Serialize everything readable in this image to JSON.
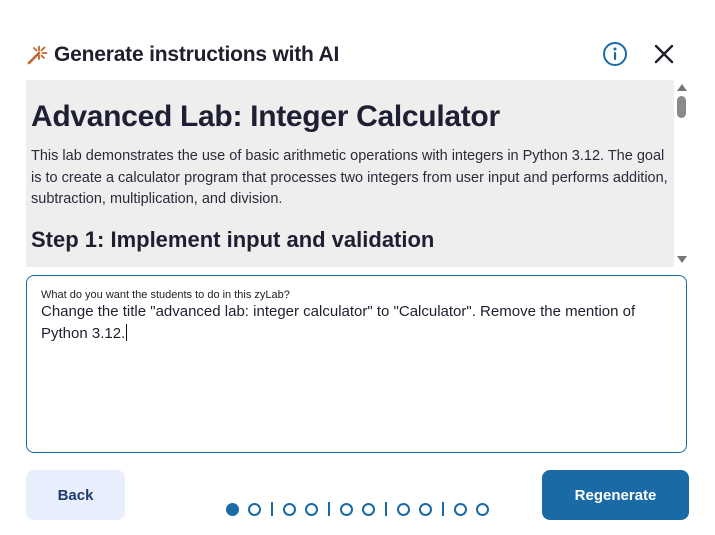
{
  "dialog": {
    "title": "Generate instructions with AI",
    "icons": {
      "title": "magic-wand-icon",
      "info": "info-icon",
      "close": "close-icon"
    },
    "colors": {
      "accent": "#1a6aa6",
      "wand": "#c0632a",
      "preview_bg": "#eeeeee",
      "back_bg": "#e8eefc"
    }
  },
  "preview": {
    "heading": "Advanced Lab: Integer Calculator",
    "paragraph": "This lab demonstrates the use of basic arithmetic operations with integers in Python 3.12. The goal is to create a calculator program that processes two integers from user input and performs addition, subtraction, multiplication, and division.",
    "step_heading": "Step 1: Implement input and validation"
  },
  "prompt": {
    "label": "What do you want the students to do in this zyLab?",
    "value": "Change the title \"advanced lab: integer calculator\" to \"Calculator\". Remove the mention of Python 3.12."
  },
  "footer": {
    "back_label": "Back",
    "regenerate_label": "Regenerate",
    "pager": {
      "groups": [
        2,
        2,
        2,
        2,
        2
      ],
      "active_index": 0
    }
  }
}
